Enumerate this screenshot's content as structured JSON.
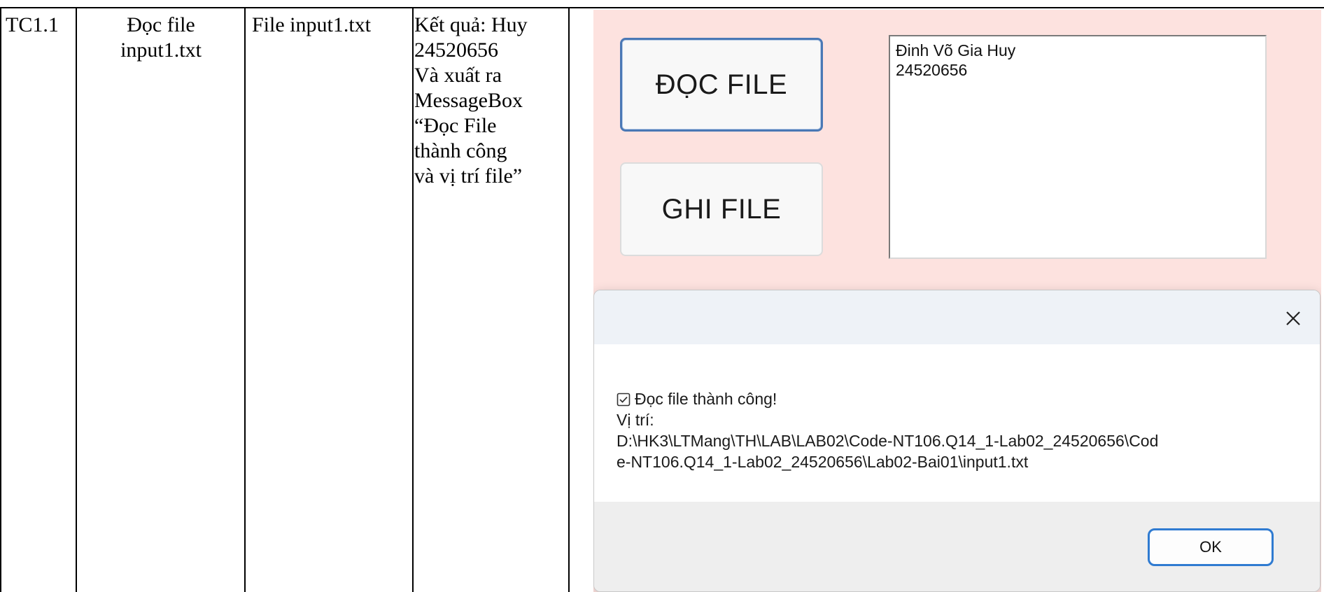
{
  "table": {
    "id": "TC1.1",
    "description": "Đọc file\ninput1.txt",
    "input": "File input1.txt",
    "expected": "Kết quả: Huy\n24520656\nVà xuất ra\nMessageBox\n“Đọc File\nthành công\nvà vị trí file”"
  },
  "app": {
    "read_button": "ĐỌC FILE",
    "write_button": "GHI FILE",
    "textbox_lines": [
      "Đinh Võ Gia Huy",
      "24520656"
    ],
    "background_color": "#fde2df"
  },
  "messagebox": {
    "close_icon": "close-icon",
    "check_icon": "checkbox-icon",
    "message": "Đọc file thành công!",
    "location_label": "Vị trí:",
    "path_line1": "D:\\HK3\\LTMang\\TH\\LAB\\LAB02\\Code-NT106.Q14_1-Lab02_24520656\\Cod",
    "path_line2": "e-NT106.Q14_1-Lab02_24520656\\Lab02-Bai01\\input1.txt",
    "ok_button": "OK"
  }
}
